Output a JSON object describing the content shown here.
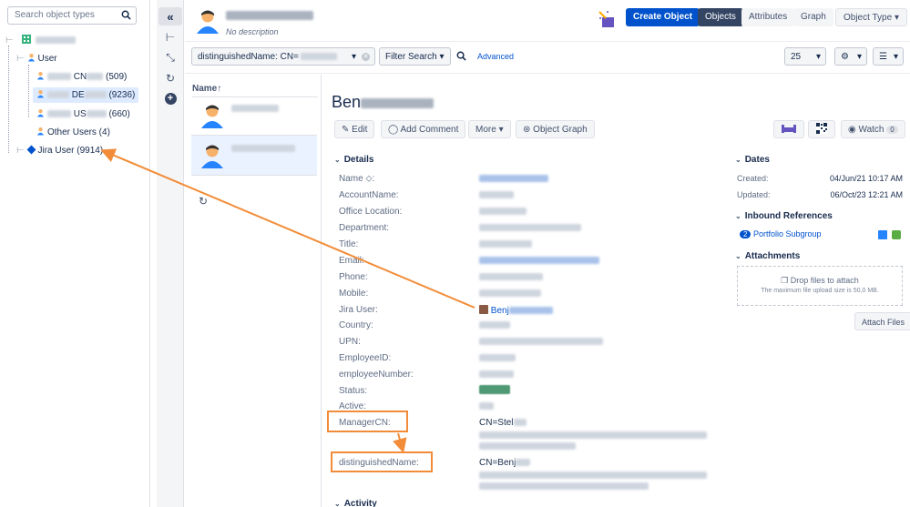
{
  "tree": {
    "search_placeholder": "Search object types",
    "items": [
      {
        "label": "User"
      },
      {
        "label_prefix": "CN",
        "count": "(509)"
      },
      {
        "label_prefix": "DE",
        "count": "(9236)"
      },
      {
        "label_prefix": "US",
        "count": "(660)"
      },
      {
        "label": "Other Users (4)"
      },
      {
        "label": "Jira User (9914)"
      }
    ]
  },
  "strip": {
    "collapse": "«",
    "tree": "⊢",
    "compress": "⤡",
    "refresh": "↻",
    "add": "+"
  },
  "header": {
    "description": "No description",
    "create_button": "Create Object",
    "tabs": [
      "Objects",
      "Attributes",
      "Graph"
    ],
    "object_type_button": "Object Type"
  },
  "filter": {
    "field": "distinguishedName: CN=",
    "filter_search": "Filter Search",
    "advanced": "Advanced",
    "page_size": "25"
  },
  "list": {
    "column_header": "Name",
    "refresh": "↻"
  },
  "detail": {
    "name_prefix": "Ben",
    "actions": {
      "edit": "Edit",
      "add_comment": "Add Comment",
      "more": "More",
      "object_graph": "Object Graph",
      "watch": "Watch",
      "watch_count": "0"
    },
    "details_title": "Details",
    "attributes": [
      {
        "label": "Name"
      },
      {
        "label": "AccountName:"
      },
      {
        "label": "Office Location:"
      },
      {
        "label": "Department:"
      },
      {
        "label": "Title:"
      },
      {
        "label": "Email:"
      },
      {
        "label": "Phone:"
      },
      {
        "label": "Mobile:"
      },
      {
        "label": "Jira User:"
      },
      {
        "label": "Country:"
      },
      {
        "label": "UPN:"
      },
      {
        "label": "EmployeeID:"
      },
      {
        "label": "employeeNumber:"
      },
      {
        "label": "Status:"
      },
      {
        "label": "Active:"
      },
      {
        "label": "ManagerCN:"
      },
      {
        "label": "distinguishedName:"
      }
    ],
    "jira_user_value": "Benj",
    "manager_cn_value": "CN=Stel",
    "dn_value": "CN=Benj",
    "activity_title": "Activity",
    "dates_title": "Dates",
    "created_label": "Created:",
    "created_value": "04/Jun/21 10:17 AM",
    "updated_label": "Updated:",
    "updated_value": "06/Oct/23 12:21 AM",
    "inbound_title": "Inbound References",
    "inbound_count": "2",
    "inbound_link": "Portfolio Subgroup",
    "attachments_title": "Attachments",
    "drop_text": "Drop files to attach",
    "drop_sub": "The maximum file upload size is 50,0 MB.",
    "attach_button": "Attach Files"
  },
  "colors": {
    "primary": "#0052cc",
    "annotation": "#f28c38",
    "active_tab": "#344563"
  }
}
